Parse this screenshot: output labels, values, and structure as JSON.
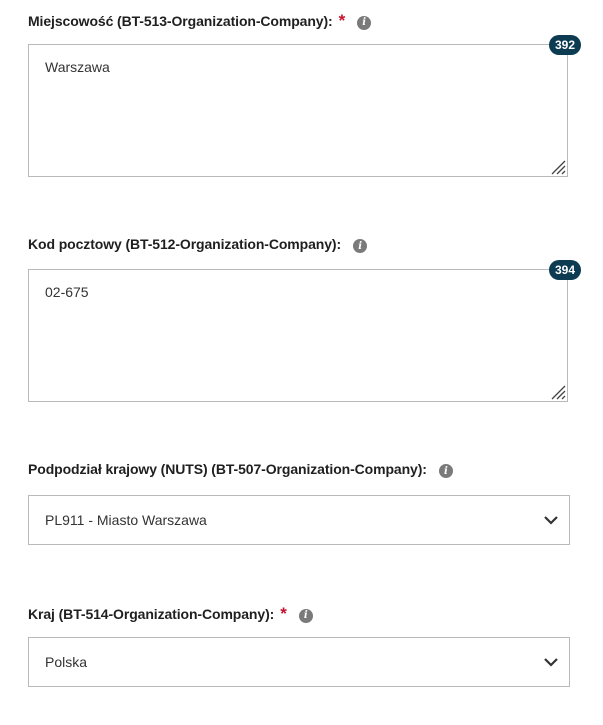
{
  "fields": {
    "city": {
      "label": "Miejscowość (BT-513-Organization-Company):",
      "required_mark": "*",
      "value": "Warszawa",
      "counter": "392"
    },
    "postal": {
      "label": "Kod pocztowy (BT-512-Organization-Company):",
      "value": "02-675",
      "counter": "394"
    },
    "nuts": {
      "label": "Podpodział krajowy (NUTS) (BT-507-Organization-Company):",
      "value": "PL911 - Miasto Warszawa"
    },
    "country": {
      "label": "Kraj (BT-514-Organization-Company):",
      "required_mark": "*",
      "value": "Polska"
    }
  },
  "icons": {
    "info": "info-icon",
    "chevron": "chevron-down-icon",
    "resize": "resize-grip-icon"
  },
  "colors": {
    "required": "#c8102e",
    "counter_bg": "#0c3b52",
    "border": "#b9b9b9"
  }
}
